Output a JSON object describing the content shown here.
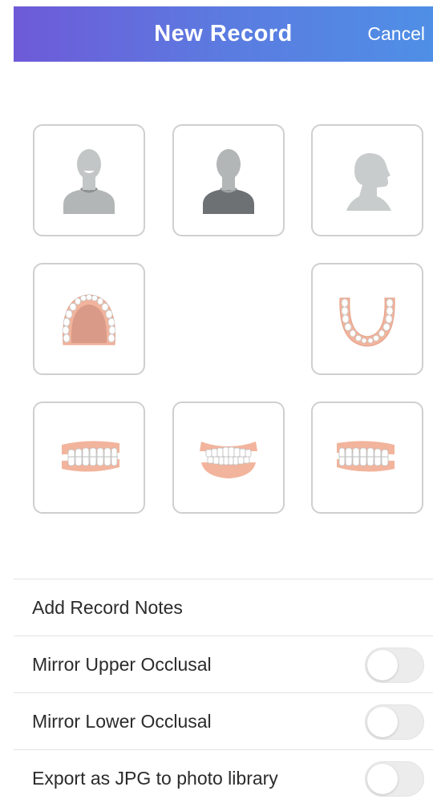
{
  "header": {
    "title": "New Record",
    "cancel_label": "Cancel",
    "gradient": [
      "#6e5ad8",
      "#4f8fe6"
    ]
  },
  "photo_slots": [
    {
      "id": "face-smile",
      "icon": "face-smile-icon"
    },
    {
      "id": "face-front",
      "icon": "face-front-icon"
    },
    {
      "id": "face-profile",
      "icon": "face-profile-icon"
    },
    {
      "id": "upper-occlusal",
      "icon": "upper-occlusal-icon"
    },
    {
      "id": "lower-occlusal",
      "icon": "lower-occlusal-icon"
    },
    {
      "id": "bite-right",
      "icon": "bite-right-icon"
    },
    {
      "id": "bite-front",
      "icon": "bite-front-icon"
    },
    {
      "id": "bite-left",
      "icon": "bite-left-icon"
    }
  ],
  "settings": {
    "notes_label": "Add Record Notes",
    "mirror_upper": {
      "label": "Mirror Upper Occlusal",
      "on": false
    },
    "mirror_lower": {
      "label": "Mirror Lower Occlusal",
      "on": false
    },
    "export_jpg": {
      "label": "Export as JPG to photo library",
      "on": false
    }
  },
  "colors": {
    "tile_border": "#cfcfcf",
    "silhouette_light": "#b3b6b6",
    "silhouette_dark": "#6d7173",
    "gum": "#f2b49c",
    "palate": "#d99b87",
    "tooth": "#ffffff"
  }
}
